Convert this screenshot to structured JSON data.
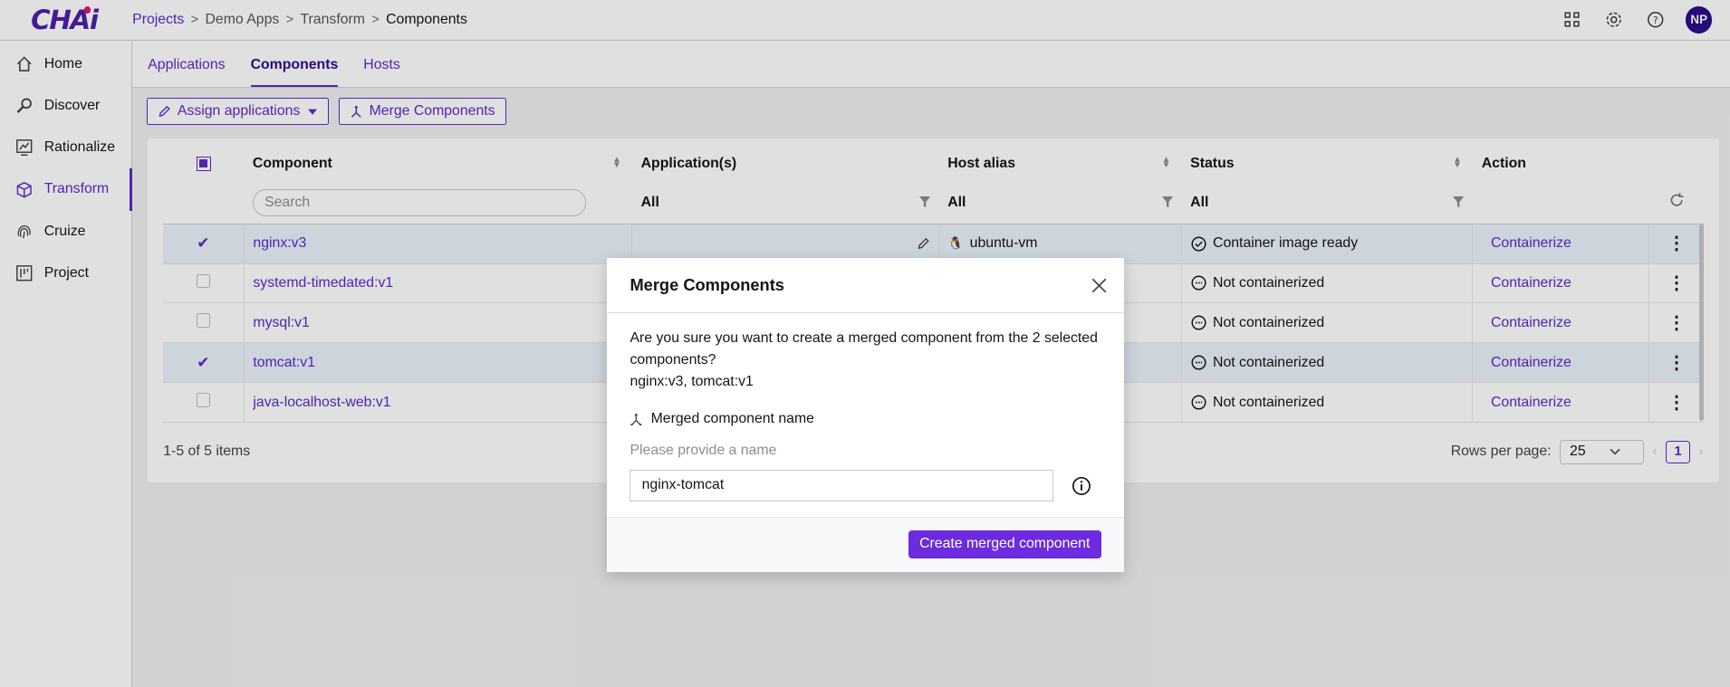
{
  "app": {
    "logo_text": "CHAi"
  },
  "breadcrumb": {
    "projects": "Projects",
    "app": "Demo Apps",
    "section": "Transform",
    "current": "Components",
    "separator": ">"
  },
  "header": {
    "avatar_initials": "NP"
  },
  "sidebar": {
    "items": [
      {
        "label": "Home",
        "icon": "home-icon"
      },
      {
        "label": "Discover",
        "icon": "search-icon"
      },
      {
        "label": "Rationalize",
        "icon": "chart-icon"
      },
      {
        "label": "Transform",
        "icon": "cube-icon"
      },
      {
        "label": "Cruize",
        "icon": "fingerprint-icon"
      },
      {
        "label": "Project",
        "icon": "project-icon"
      }
    ]
  },
  "tabs": [
    {
      "label": "Applications"
    },
    {
      "label": "Components"
    },
    {
      "label": "Hosts"
    }
  ],
  "toolbar": {
    "assign_label": "Assign applications",
    "merge_label": "Merge Components"
  },
  "table": {
    "headers": {
      "component": "Component",
      "applications": "Application(s)",
      "host_alias": "Host alias",
      "status": "Status",
      "action": "Action"
    },
    "search_placeholder": "Search",
    "filters": {
      "applications": "All",
      "host_alias": "All",
      "status": "All"
    },
    "rows": [
      {
        "component": "nginx:v3",
        "host": "ubuntu-vm",
        "status": "Container image ready",
        "action": "Containerize",
        "selected": true
      },
      {
        "component": "systemd-timedated:v1",
        "host": "",
        "status": "Not containerized",
        "action": "Containerize",
        "selected": false
      },
      {
        "component": "mysql:v1",
        "host": "",
        "status": "Not containerized",
        "action": "Containerize",
        "selected": false
      },
      {
        "component": "tomcat:v1",
        "host": "",
        "status": "Not containerized",
        "action": "Containerize",
        "selected": true
      },
      {
        "component": "java-localhost-web:v1",
        "host": "",
        "status": "Not containerized",
        "action": "Containerize",
        "selected": false
      }
    ]
  },
  "pagination": {
    "range": "1-5 of 5 items",
    "rows_label": "Rows per page:",
    "rows_value": "25",
    "page": "1"
  },
  "modal": {
    "title": "Merge Components",
    "message": "Are you sure you want to create a merged component from the 2 selected components?",
    "components": "nginx:v3, tomcat:v1",
    "field_label": "Merged component name",
    "hint": "Please provide a name",
    "input_value": "nginx-tomcat",
    "submit_label": "Create merged component"
  }
}
